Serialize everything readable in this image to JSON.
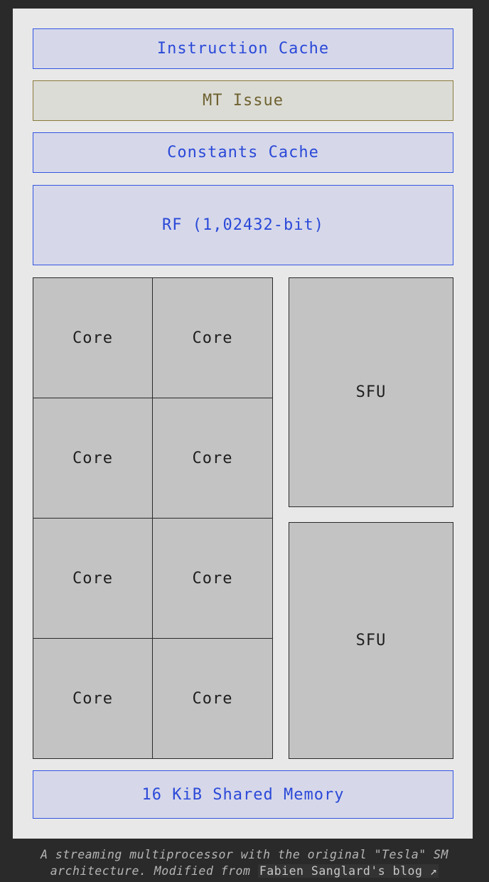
{
  "diagram": {
    "instruction_cache": "Instruction Cache",
    "mt_issue": "MT Issue",
    "constants_cache": "Constants Cache",
    "register_file": "RF (1,02432-bit)",
    "cores": [
      "Core",
      "Core",
      "Core",
      "Core",
      "Core",
      "Core",
      "Core",
      "Core"
    ],
    "sfus": [
      "SFU",
      "SFU"
    ],
    "shared_memory": "16 KiB Shared Memory"
  },
  "caption": {
    "text_line1": "A streaming multiprocessor with the original \"Tesla\" SM",
    "text_line2_prefix": "architecture. Modified from",
    "link_text": "Fabien Sanglard's blog ↗"
  },
  "colors": {
    "page_background": "#2a2a2a",
    "panel_background": "#e8e8e8",
    "cache_fill": "#d6d8ea",
    "cache_accent": "#3355e0",
    "issue_fill": "#dcdcd6",
    "issue_accent": "#8a7a3c",
    "unit_fill": "#c2c3c2"
  }
}
